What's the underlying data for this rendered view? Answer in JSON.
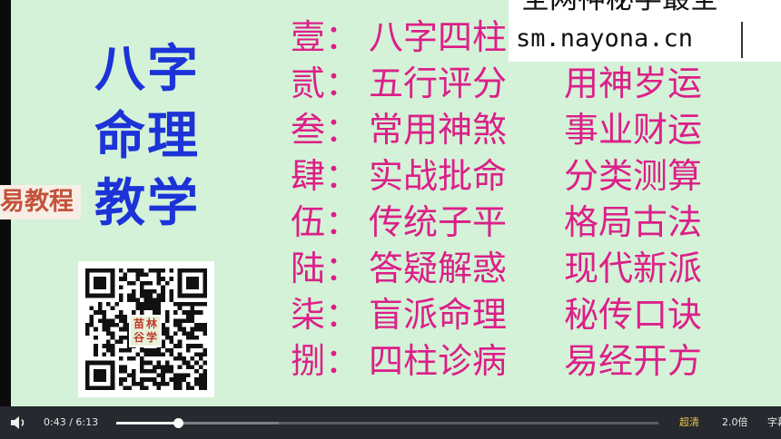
{
  "slide": {
    "title_lines": [
      "八字",
      "命理",
      "教学"
    ],
    "side_tag": "易教程",
    "qr_logo": [
      "苗",
      "林",
      "谷",
      "学"
    ],
    "rows": [
      {
        "label": "壹：",
        "col1": "八字四柱",
        "col2": ""
      },
      {
        "label": "贰：",
        "col1": "五行评分",
        "col2": "用神岁运"
      },
      {
        "label": "叁：",
        "col1": "常用神煞",
        "col2": "事业财运"
      },
      {
        "label": "肆：",
        "col1": "实战批命",
        "col2": "分类测算"
      },
      {
        "label": "伍：",
        "col1": "传统子平",
        "col2": "格局古法"
      },
      {
        "label": "陆：",
        "col1": "答疑解惑",
        "col2": "现代新派"
      },
      {
        "label": "柒：",
        "col1": "盲派命理",
        "col2": "秘传口诀"
      },
      {
        "label": "捌：",
        "col1": "四柱诊病",
        "col2": "易经开方"
      }
    ],
    "watermark": {
      "top_text": "全网神秘学最全",
      "url": "sm.nayona.cn"
    }
  },
  "player": {
    "current_time": "0:43",
    "separator": "/",
    "duration": "6:13",
    "progress": 0.115,
    "buffered": 0.3,
    "quality_label": "超清",
    "speed_label": "2.0倍",
    "subtitle_label": "字幕",
    "colors": {
      "accent": "#e8c34a",
      "bar_bg": "#26292f"
    },
    "icons": {
      "volume": "speaker-icon"
    }
  }
}
